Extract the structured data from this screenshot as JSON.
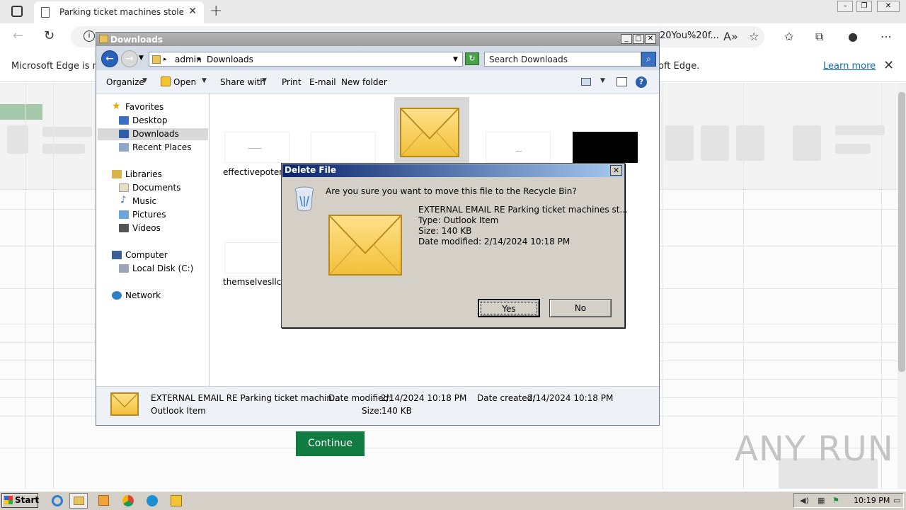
{
  "browser": {
    "tab_title": "Parking ticket machines stolen fr",
    "url_tail": "20You%20f...",
    "infobar_left": "Microsoft Edge is no",
    "infobar_right": "oft Edge.",
    "learn_more": "Learn more"
  },
  "background_page": {
    "continue_label": "Continue",
    "watermark": "ANY RUN"
  },
  "explorer": {
    "title": "Downloads",
    "path": [
      "admin",
      "Downloads"
    ],
    "search_placeholder": "Search Downloads",
    "commands": [
      "Organize",
      "Open",
      "Share with",
      "Print",
      "E-mail",
      "New folder"
    ],
    "nav": {
      "favorites": "Favorites",
      "favorites_items": [
        "Desktop",
        "Downloads",
        "Recent Places"
      ],
      "libraries": "Libraries",
      "libraries_items": [
        "Documents",
        "Music",
        "Pictures",
        "Videos"
      ],
      "computer": "Computer",
      "computer_items": [
        "Local Disk (C:)"
      ],
      "network": "Network"
    },
    "files": [
      {
        "label": "effectivepotentiang"
      },
      {
        "label": "themselvesllc.pr"
      }
    ],
    "details": {
      "name": "EXTERNAL EMAIL RE Parking ticket machin...",
      "type": "Outlook Item",
      "date_modified_label": "Date modified:",
      "date_modified": "2/14/2024 10:18 PM",
      "date_created_label": "Date created:",
      "date_created": "2/14/2024 10:18 PM",
      "size_label": "Size:",
      "size": "140 KB"
    }
  },
  "dialog": {
    "title": "Delete File",
    "question": "Are you sure you want to move this file to the Recycle Bin?",
    "file_name": "EXTERNAL EMAIL RE Parking ticket machines st...",
    "file_type": "Type: Outlook Item",
    "file_size": "Size: 140 KB",
    "file_date": "Date modified: 2/14/2024 10:18 PM",
    "yes": "Yes",
    "no": "No"
  },
  "taskbar": {
    "start": "Start",
    "clock": "10:19 PM"
  }
}
